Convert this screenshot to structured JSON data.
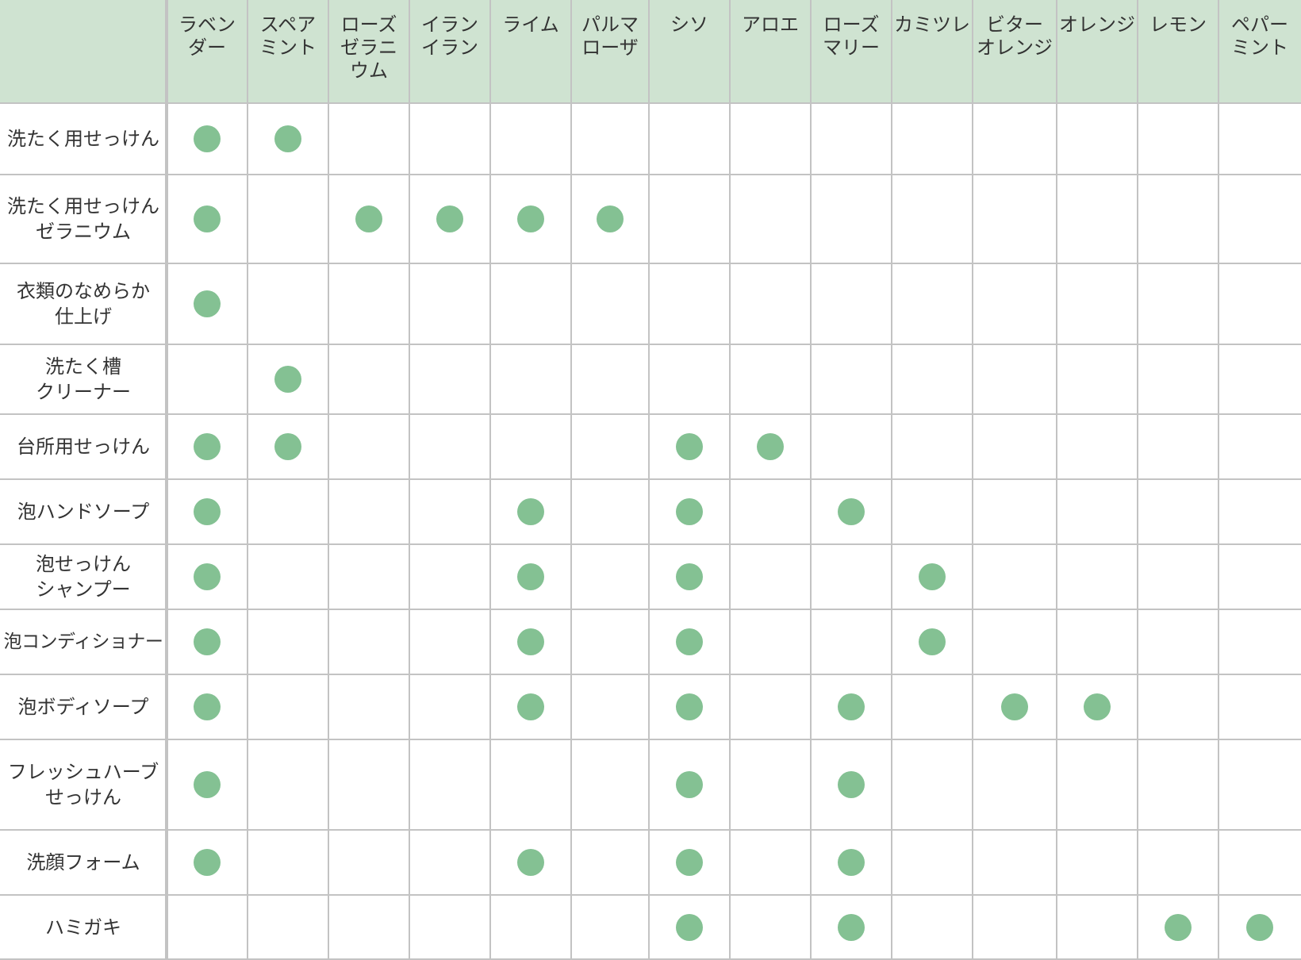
{
  "columns": [
    "ラベン\nダー",
    "スペア\nミント",
    "ローズ\nゼラニ\nウム",
    "イラン\nイラン",
    "ライム",
    "パルマ\nローザ",
    "シソ",
    "アロエ",
    "ローズ\nマリー",
    "カミツレ",
    "ビター\nオレンジ",
    "オレンジ",
    "レモン",
    "ペパー\nミント"
  ],
  "rows": [
    {
      "label": "洗たく用せっけん",
      "marks": [
        0,
        1
      ]
    },
    {
      "label": "洗たく用せっけん\nゼラニウム",
      "marks": [
        0,
        2,
        3,
        4,
        5
      ]
    },
    {
      "label": "衣類のなめらか\n仕上げ",
      "marks": [
        0
      ]
    },
    {
      "label": "洗たく槽\nクリーナー",
      "marks": [
        1
      ]
    },
    {
      "label": "台所用せっけん",
      "marks": [
        0,
        1,
        6,
        7
      ]
    },
    {
      "label": "泡ハンドソープ",
      "marks": [
        0,
        4,
        6,
        8
      ]
    },
    {
      "label": "泡せっけん\nシャンプー",
      "marks": [
        0,
        4,
        6,
        9
      ]
    },
    {
      "label": "泡コンディショナー",
      "marks": [
        0,
        4,
        6,
        9
      ]
    },
    {
      "label": "泡ボディソープ",
      "marks": [
        0,
        4,
        6,
        8,
        10,
        11
      ]
    },
    {
      "label": "フレッシュハーブ\nせっけん",
      "marks": [
        0,
        6,
        8
      ]
    },
    {
      "label": "洗顔フォーム",
      "marks": [
        0,
        4,
        6,
        8
      ]
    },
    {
      "label": "ハミガキ",
      "marks": [
        6,
        8,
        12,
        13
      ]
    }
  ],
  "colors": {
    "header_bg": "#cfe3d1",
    "dot": "#84c193",
    "grid": "#c3c3c3",
    "text": "#333333"
  }
}
